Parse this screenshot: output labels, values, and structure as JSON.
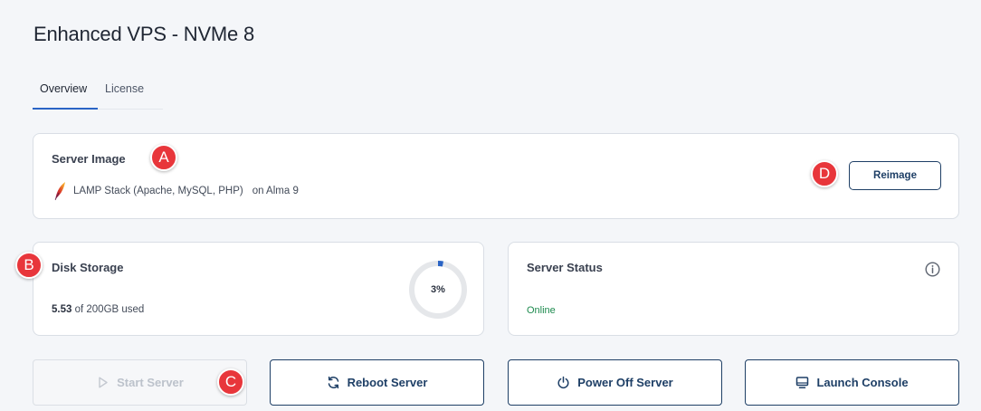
{
  "page": {
    "title": "Enhanced VPS - NVMe 8"
  },
  "tabs": [
    {
      "label": "Overview",
      "active": true
    },
    {
      "label": "License",
      "active": false
    }
  ],
  "server_image": {
    "title": "Server Image",
    "image_name": "LAMP Stack (Apache, MySQL, PHP)",
    "os": "on Alma 9",
    "reimage_label": "Reimage",
    "icon": "feather-icon"
  },
  "disk": {
    "title": "Disk Storage",
    "used": "5.53",
    "total_text": "of 200GB used",
    "percent_label": "3%",
    "percent": 3
  },
  "status": {
    "title": "Server Status",
    "value": "Online",
    "icon": "info-icon"
  },
  "actions": {
    "start": "Start Server",
    "reboot": "Reboot Server",
    "power_off": "Power Off Server",
    "console": "Launch Console"
  },
  "markers": {
    "a": "A",
    "b": "B",
    "c": "C",
    "d": "D"
  },
  "colors": {
    "accent": "#1e3f66",
    "gauge_fill": "#2a64c5",
    "gauge_track": "#e5e7ea",
    "online": "#1d8a4e",
    "marker": "#e8363b"
  }
}
